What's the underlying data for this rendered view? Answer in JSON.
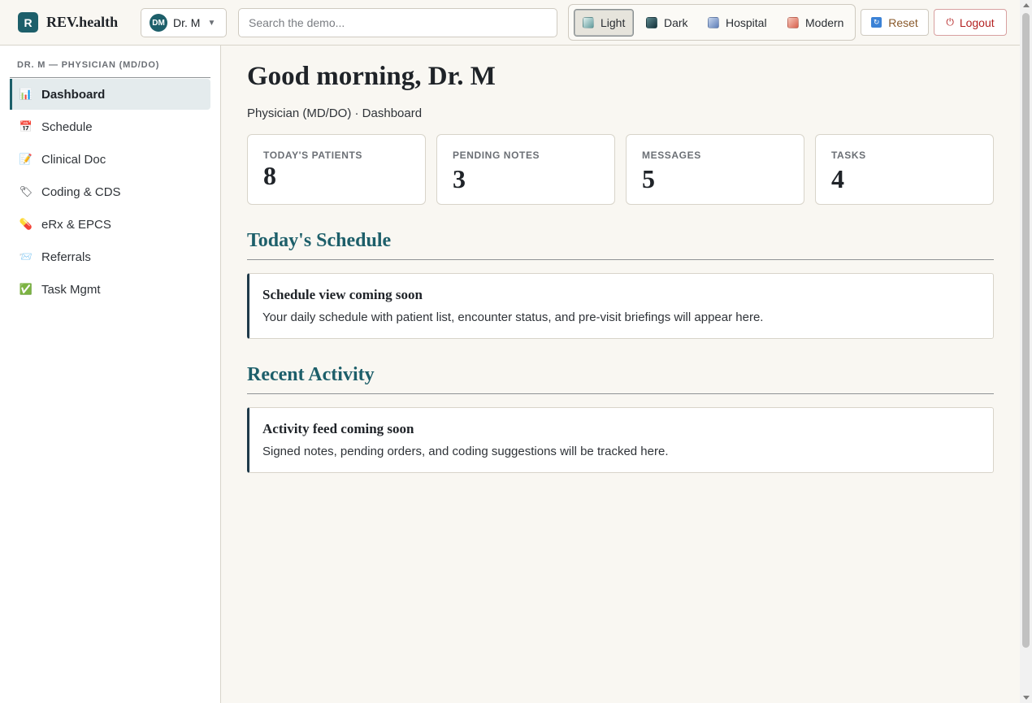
{
  "brand": {
    "logo_letter": "R",
    "name": "REV.health"
  },
  "user": {
    "initials": "DM",
    "name": "Dr. M"
  },
  "search": {
    "placeholder": "Search the demo...",
    "value": ""
  },
  "themes": [
    {
      "label": "Light",
      "active": true,
      "color": "#9fc3c3"
    },
    {
      "label": "Dark",
      "active": false,
      "color": "#2b4a52"
    },
    {
      "label": "Hospital",
      "active": false,
      "color": "#7f9ccc"
    },
    {
      "label": "Modern",
      "active": false,
      "color": "#e08a7a"
    }
  ],
  "actions": {
    "reset_label": "Reset",
    "logout_label": "Logout"
  },
  "sidebar": {
    "role_heading": "DR. M — PHYSICIAN (MD/DO)",
    "items": [
      {
        "label": "Dashboard",
        "icon": "bar-chart-icon",
        "glyph": "📊",
        "active": true
      },
      {
        "label": "Schedule",
        "icon": "calendar-icon",
        "glyph": "📅",
        "active": false
      },
      {
        "label": "Clinical Doc",
        "icon": "memo-icon",
        "glyph": "📝",
        "active": false
      },
      {
        "label": "Coding & CDS",
        "icon": "tag-icon",
        "glyph": "🏷",
        "active": false
      },
      {
        "label": "eRx & EPCS",
        "icon": "pill-icon",
        "glyph": "💊",
        "active": false
      },
      {
        "label": "Referrals",
        "icon": "envelope-icon",
        "glyph": "📨",
        "active": false
      },
      {
        "label": "Task Mgmt",
        "icon": "check-box-icon",
        "glyph": "✅",
        "active": false
      }
    ]
  },
  "main": {
    "greeting": "Good morning, Dr. M",
    "subtitle": "Physician (MD/DO) · Dashboard",
    "stats": [
      {
        "label": "TODAY'S PATIENTS",
        "value": "8"
      },
      {
        "label": "PENDING NOTES",
        "value": "3"
      },
      {
        "label": "MESSAGES",
        "value": "5"
      },
      {
        "label": "TASKS",
        "value": "4"
      }
    ],
    "schedule": {
      "heading": "Today's Schedule",
      "card_title": "Schedule view coming soon",
      "card_text": "Your daily schedule with patient list, encounter status, and pre-visit briefings will appear here."
    },
    "activity": {
      "heading": "Recent Activity",
      "card_title": "Activity feed coming soon",
      "card_text": "Signed notes, pending orders, and coding suggestions will be tracked here."
    }
  },
  "colors": {
    "brand": "#1d5f6a",
    "danger": "#b42323",
    "background": "#f9f7f2"
  }
}
